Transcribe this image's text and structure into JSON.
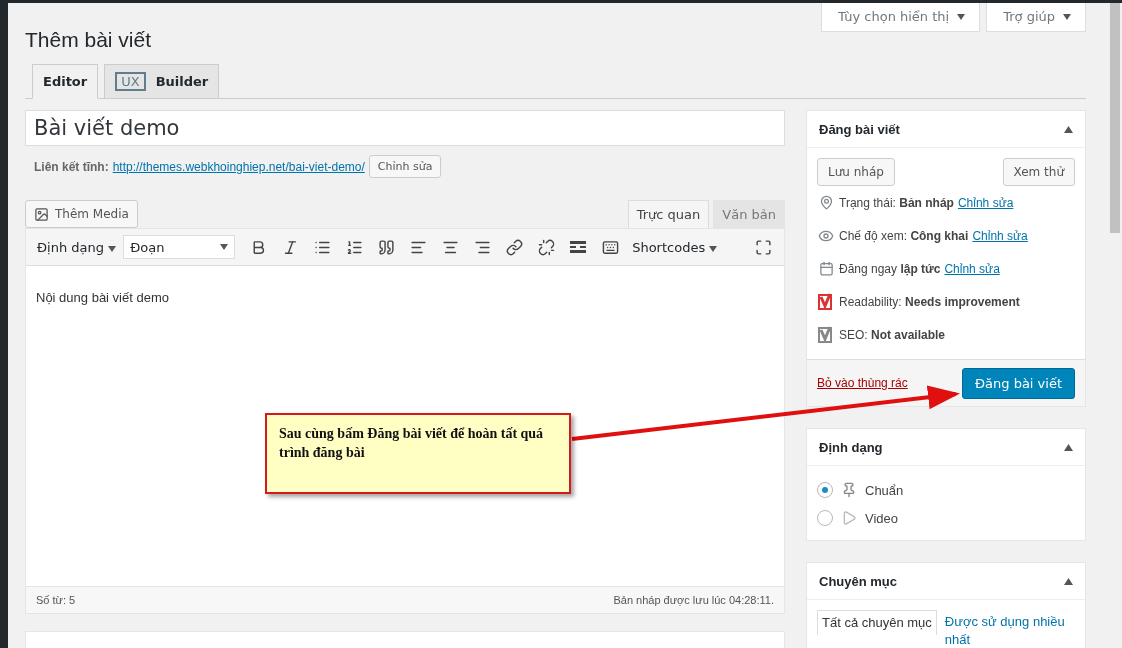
{
  "header_buttons": [
    {
      "label": "Tùy chọn hiển thị"
    },
    {
      "label": "Trợ giúp"
    }
  ],
  "page_title": "Thêm bài viết",
  "builder_tabs": [
    {
      "label": "Editor",
      "selected": true
    },
    {
      "label": "Builder",
      "badge": "UX",
      "selected": false
    }
  ],
  "post_title": "Bài viết demo",
  "permalink": {
    "label": "Liên kết tĩnh:",
    "url": "http://themes.webkhoinghiep.net/bai-viet-demo/",
    "edit_button": "Chỉnh sửa"
  },
  "add_media_button": "Thêm Media",
  "editor_tabs": [
    {
      "label": "Trực quan",
      "selected": true
    },
    {
      "label": "Văn bản",
      "selected": false
    }
  ],
  "toolbar": {
    "format_menu": "Định dạng",
    "paragraph_select": "Đoạn",
    "shortcodes_menu": "Shortcodes"
  },
  "content": "Nội dung bài viết demo",
  "status_bar": {
    "word_count": "Số từ: 5",
    "saved": "Bản nháp được lưu lúc 04:28:11."
  },
  "publish_box": {
    "title": "Đăng bài viết",
    "save_draft": "Lưu nháp",
    "preview": "Xem thử",
    "meta": [
      {
        "kind": "status",
        "text": "Trạng thái: **Bản nháp**",
        "link": "Chỉnh sửa"
      },
      {
        "kind": "visibility",
        "text": "Chế độ xem: **Công khai**",
        "link": "Chỉnh sửa"
      },
      {
        "kind": "schedule",
        "text": "Đăng ngay **lập tức**",
        "link": "Chỉnh sửa"
      },
      {
        "kind": "readability",
        "text": "Readability: **Needs improvement**",
        "color": "#dc3232"
      },
      {
        "kind": "seo",
        "text": "SEO: **Not available**",
        "color": "#888888"
      }
    ],
    "trash": "Bỏ vào thùng rác",
    "publish": "Đăng bài viết"
  },
  "format_box": {
    "title": "Định dạng",
    "options": [
      {
        "kind": "standard",
        "label": "Chuẩn",
        "selected": true
      },
      {
        "kind": "video",
        "label": "Video",
        "selected": false
      }
    ]
  },
  "category_box": {
    "title": "Chuyên mục",
    "tabs": [
      {
        "label": "Tất cả chuyên mục",
        "selected": true
      },
      {
        "label": "Được sử dụng nhiều nhất",
        "selected": false
      }
    ]
  },
  "callout": {
    "text": "Sau cùng bấm Đăng bài viết để hoàn tất quá trình đăng bài"
  }
}
